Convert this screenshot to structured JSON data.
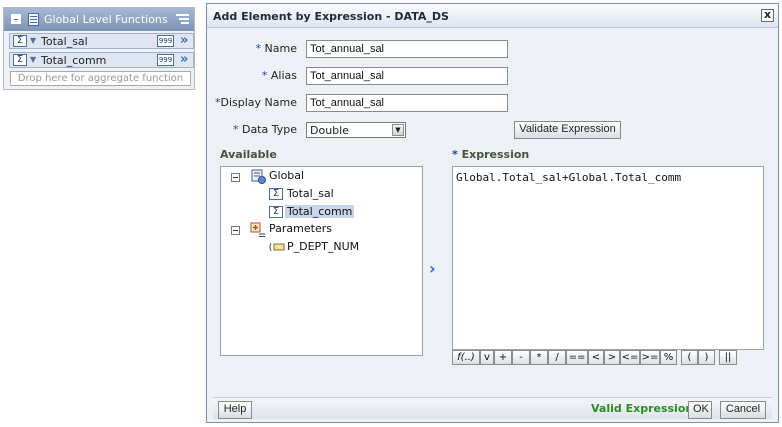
{
  "global_panel": {
    "title": "Global Level Functions",
    "items": [
      {
        "label": "Total_sal",
        "badge": "999",
        "more": "»"
      },
      {
        "label": "Total_comm",
        "badge": "999",
        "more": "»"
      }
    ],
    "drop_hint": "Drop here for aggregate function"
  },
  "dialog": {
    "title": "Add Element by Expression - DATA_DS",
    "close_glyph": "x",
    "fields": {
      "name_label": "Name",
      "name_value": "Tot_annual_sal",
      "alias_label": "Alias",
      "alias_value": "Tot_annual_sal",
      "display_label": "Display Name",
      "display_value": "Tot_annual_sal",
      "datatype_label": "Data Type",
      "datatype_value": "Double",
      "required_mark": "*"
    },
    "validate_button": "Validate Expression",
    "available_heading": "Available",
    "expression_heading": "Expression",
    "tree": {
      "global_label": "Global",
      "global_items": [
        "Total_sal",
        "Total_comm"
      ],
      "params_label": "Parameters",
      "param_items": [
        "P_DEPT_NUM"
      ]
    },
    "move_glyph": "›",
    "expression_text": "Global.Total_sal+Global.Total_comm",
    "operators": [
      "f(..)",
      "v",
      "+",
      "-",
      "*",
      "/",
      "==",
      "<",
      ">",
      "<=",
      ">=",
      "%",
      "(",
      ")",
      "||"
    ],
    "footer": {
      "help_button": "Help",
      "status": "Valid Expression",
      "ok_button": "OK",
      "cancel_button": "Cancel"
    }
  },
  "colors": {
    "status_valid": "#2e8b23",
    "accent_blue": "#3b6bb2"
  }
}
